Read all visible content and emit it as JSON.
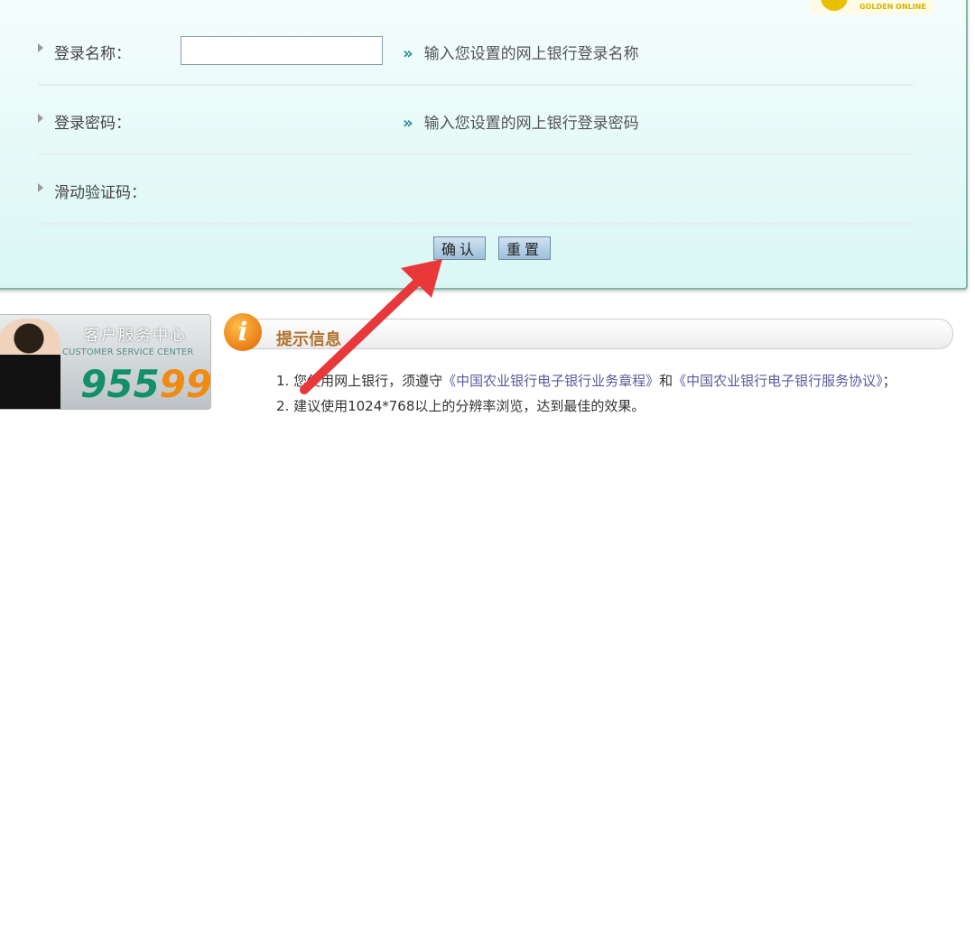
{
  "logo": {
    "text": "GOLDEN ONLINE"
  },
  "form": {
    "rows": [
      {
        "label": "登录名称：",
        "hint": "输入您设置的网上银行登录名称",
        "has_input": true
      },
      {
        "label": "登录密码：",
        "hint": "输入您设置的网上银行登录密码"
      },
      {
        "label": "滑动验证码："
      }
    ],
    "hint_icon": "double-chevron-right-icon",
    "username_value": "",
    "confirm_label": "确认",
    "reset_label": "重置"
  },
  "service": {
    "title": "客户服务中心",
    "subtitle": "CUSTOMER SERVICE CENTER",
    "number_a": "955",
    "number_b": "99"
  },
  "tips": {
    "icon": "info-icon",
    "title": "提示信息",
    "line1_prefix": "1. 您使用网上银行，须遵守",
    "link1": "《中国农业银行电子银行业务章程》",
    "line1_mid": "和",
    "link2": "《中国农业银行电子银行服务协议》",
    "line1_suffix": "；",
    "line2": "2. 建议使用1024*768以上的分辨率浏览，达到最佳的效果。"
  },
  "annotation": {
    "arrow_color": "#e8383a"
  }
}
